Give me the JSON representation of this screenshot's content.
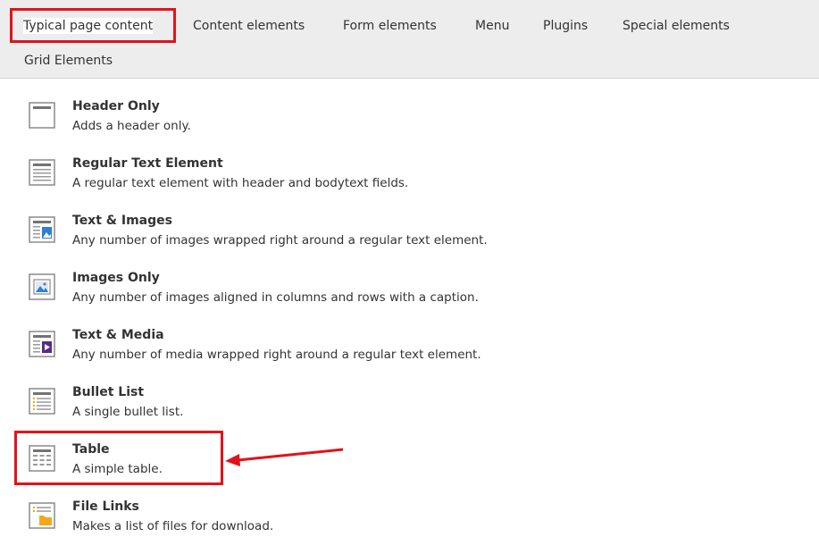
{
  "tabs": [
    {
      "label": "Typical page content",
      "active": true
    },
    {
      "label": "Content elements",
      "active": false
    },
    {
      "label": "Form elements",
      "active": false
    },
    {
      "label": "Menu",
      "active": false
    },
    {
      "label": "Plugins",
      "active": false
    },
    {
      "label": "Special elements",
      "active": false
    },
    {
      "label": "Grid Elements",
      "active": false
    }
  ],
  "items": [
    {
      "title": "Header Only",
      "description": "Adds a header only.",
      "icon": "header-only-icon"
    },
    {
      "title": "Regular Text Element",
      "description": "A regular text element with header and bodytext fields.",
      "icon": "text-element-icon"
    },
    {
      "title": "Text & Images",
      "description": "Any number of images wrapped right around a regular text element.",
      "icon": "text-images-icon"
    },
    {
      "title": "Images Only",
      "description": "Any number of images aligned in columns and rows with a caption.",
      "icon": "images-only-icon"
    },
    {
      "title": "Text & Media",
      "description": "Any number of media wrapped right around a regular text element.",
      "icon": "text-media-icon"
    },
    {
      "title": "Bullet List",
      "description": "A single bullet list.",
      "icon": "bullet-list-icon"
    },
    {
      "title": "Table",
      "description": "A simple table.",
      "icon": "table-icon"
    },
    {
      "title": "File Links",
      "description": "Makes a list of files for download.",
      "icon": "file-links-icon"
    }
  ],
  "colors": {
    "highlight": "#e0131b",
    "tabbar_bg": "#ededed",
    "icon_gray": "#737373",
    "icon_blue": "#2e7fd6",
    "icon_purple": "#5b2a86",
    "icon_yellow": "#f3a81b"
  }
}
